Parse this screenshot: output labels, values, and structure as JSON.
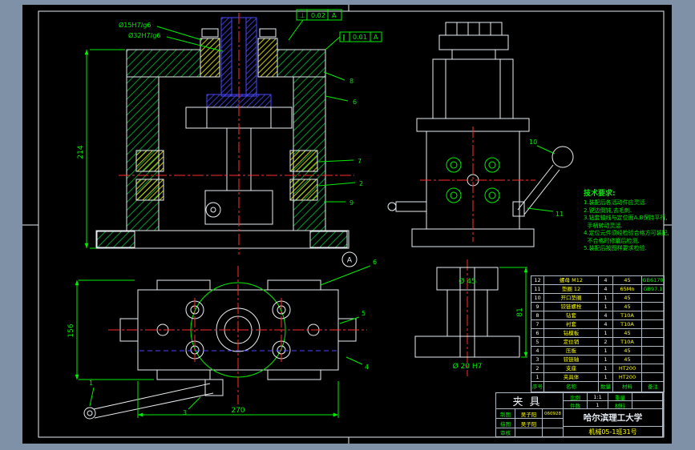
{
  "window": {
    "background": "#7e91a7",
    "canvas": "#000000"
  },
  "dims": {
    "front_height": "214",
    "plan_height": "156",
    "plan_width": "270",
    "detail_height": "81",
    "detail_top_dia": "Ø 45",
    "detail_hole_dia": "Ø 20 H7",
    "fit_label_1": "Ø15H7/g6",
    "fit_label_2": "Ø32H7/g6"
  },
  "gdt": {
    "frame1": {
      "symbol": "⊥",
      "value": "0.02",
      "datum": "A"
    },
    "frame2": {
      "symbol": "∥",
      "value": "0.01",
      "datum": "A"
    }
  },
  "section_label": "A",
  "callouts": [
    "1",
    "2",
    "3",
    "4",
    "5",
    "6",
    "7",
    "8",
    "9",
    "10",
    "11"
  ],
  "tech_req": {
    "title": "技术要求:",
    "lines": [
      "1.装配后各活动件应灵活.",
      "2.锐边倒钝,去毛刺.",
      "3.钻套轴线与定位面A.B保持平行,",
      "  手柄转动灵活.",
      "4.定位元件须经检验合格方可装配,",
      "  不合格时修磨后检测.",
      "5.装配后按图样要求检验."
    ]
  },
  "bom": {
    "headers": [
      "序号",
      "名称",
      "数量",
      "材料",
      "备注"
    ],
    "rows": [
      [
        "12",
        "螺母 M12",
        "4",
        "45",
        "GB6170"
      ],
      [
        "11",
        "垫圈 12",
        "4",
        "65Mn",
        "GB97.1"
      ],
      [
        "10",
        "开口垫圈",
        "1",
        "45",
        ""
      ],
      [
        "9",
        "铰链螺栓",
        "1",
        "45",
        ""
      ],
      [
        "8",
        "钻套",
        "4",
        "T10A",
        ""
      ],
      [
        "7",
        "衬套",
        "4",
        "T10A",
        ""
      ],
      [
        "6",
        "钻模板",
        "1",
        "45",
        ""
      ],
      [
        "5",
        "定位销",
        "2",
        "T10A",
        ""
      ],
      [
        "4",
        "压板",
        "1",
        "45",
        ""
      ],
      [
        "3",
        "铰链轴",
        "1",
        "45",
        ""
      ],
      [
        "2",
        "支座",
        "1",
        "HT200",
        ""
      ],
      [
        "1",
        "夹具体",
        "1",
        "HT200",
        ""
      ]
    ]
  },
  "title_block": {
    "part_name": "夹具",
    "scale_label": "比例",
    "scale_value": "1:1",
    "qty_label": "件数",
    "qty_value": "1",
    "weight_label": "重量",
    "material_label": "材料",
    "drawn_label": "制图",
    "drawn_name": "吴子阳",
    "drawn_date": "060928",
    "traced_label": "描图",
    "traced_name": "吴子阳",
    "checked_label": "审核",
    "school": "哈尔滨理工大学",
    "class_no": "机械05-1班31号"
  }
}
